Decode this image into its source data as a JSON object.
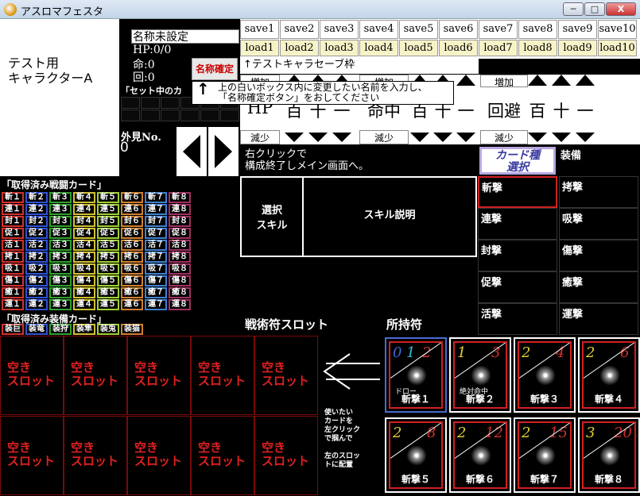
{
  "window": {
    "title": "アスロマフェスタ",
    "min": "─",
    "max": "□",
    "close": "X"
  },
  "character": {
    "label": "テスト用\nキャラクターA",
    "name_value": "名称未設定",
    "hp": "HP:0/0",
    "life": "命:0",
    "turn": "回:0",
    "confirm_btn": "名称確定",
    "set_card_label": "「セット中のカ",
    "appearance_label": "外見No.",
    "appearance_value": "0"
  },
  "save_slots": [
    {
      "save": "save1",
      "load": "load1"
    },
    {
      "save": "save2",
      "load": "load2"
    },
    {
      "save": "save3",
      "load": "load3"
    },
    {
      "save": "save4",
      "load": "load4"
    },
    {
      "save": "save5",
      "load": "load5"
    },
    {
      "save": "save6",
      "load": "load6"
    },
    {
      "save": "save7",
      "load": "load7"
    },
    {
      "save": "save8",
      "load": "load8"
    },
    {
      "save": "save9",
      "load": "load9"
    },
    {
      "save": "save10",
      "load": "load10"
    }
  ],
  "save_caption": "↑テストキャラセーブ枠",
  "tooltip": {
    "arrow": "↑",
    "text": "上の白いボックス内に変更したい名前を入力し、\n「名称確定ボタン」をおしてください"
  },
  "stats": {
    "left": {
      "inc": "増加",
      "dec": "減少",
      "value": "HP"
    },
    "middle": {
      "inc": "増加",
      "dec": "減少",
      "value": "命中"
    },
    "right": {
      "inc": "増加",
      "dec": "減少",
      "value": "回避"
    },
    "digits": [
      "百",
      "十",
      "一"
    ]
  },
  "right_click_text": "右クリックで\n構成終了しメイン画面へ。",
  "card_type_btn": "カード種\n選択",
  "equip_header": "装備",
  "categories": [
    {
      "left": "斬撃",
      "right": "拷撃"
    },
    {
      "left": "連撃",
      "right": "吸撃"
    },
    {
      "left": "封撃",
      "right": "傷撃"
    },
    {
      "left": "促撃",
      "right": "癒撃"
    },
    {
      "left": "活撃",
      "right": "運撃"
    }
  ],
  "battle_cards_title": "「取得済み戦闘カード」",
  "battle_rows": [
    "斬",
    "連",
    "封",
    "促",
    "活",
    "拷",
    "吸",
    "傷",
    "癒",
    "運"
  ],
  "battle_colors": [
    "#d03030",
    "#3050d0",
    "#30a030",
    "#d0c030",
    "#a0d030",
    "#d08030",
    "#4080d0",
    "#a03060",
    "#c030c0",
    "#c09030"
  ],
  "equip_cards_title": "「取得済み装備カード」",
  "equip_cards": [
    "装巨",
    "装竜",
    "装狩",
    "装隼",
    "装兎",
    "装猫"
  ],
  "skill": {
    "select": "選択\nスキル",
    "desc": "スキル説明"
  },
  "slots_header": "戦術符スロット",
  "owned_header": "所持符",
  "empty_slot": "空き\nスロット",
  "instructions": "使いたい\nカードを\n左クリック\nで掴んで\n\n左のスロッ\nトに配置",
  "owned_cards": [
    {
      "nums": [
        "0",
        "1",
        "2"
      ],
      "colors": [
        "#3a6ad0",
        "#30c0d0",
        "#d03030"
      ],
      "tag": "ドロー",
      "name": "斬撃１"
    },
    {
      "nums": [
        "1",
        "3"
      ],
      "colors": [
        "#e0d030",
        "#d03030"
      ],
      "tag": "絶対命中",
      "name": "斬撃２"
    },
    {
      "nums": [
        "2",
        "4"
      ],
      "colors": [
        "#e0d030",
        "#d03030"
      ],
      "tag": "",
      "name": "斬撃３"
    },
    {
      "nums": [
        "2",
        "6"
      ],
      "colors": [
        "#e0d030",
        "#d03030"
      ],
      "tag": "",
      "name": "斬撃４"
    },
    {
      "nums": [
        "2",
        "8"
      ],
      "colors": [
        "#e0d030",
        "#d03030"
      ],
      "tag": "",
      "name": "斬撃５"
    },
    {
      "nums": [
        "2",
        "12"
      ],
      "colors": [
        "#e0d030",
        "#d03030"
      ],
      "tag": "",
      "name": "斬撃６"
    },
    {
      "nums": [
        "2",
        "15"
      ],
      "colors": [
        "#e0d030",
        "#d03030"
      ],
      "tag": "",
      "name": "斬撃７"
    },
    {
      "nums": [
        "3",
        "20"
      ],
      "colors": [
        "#e0d030",
        "#d03030"
      ],
      "tag": "",
      "name": "斬撃８"
    }
  ]
}
